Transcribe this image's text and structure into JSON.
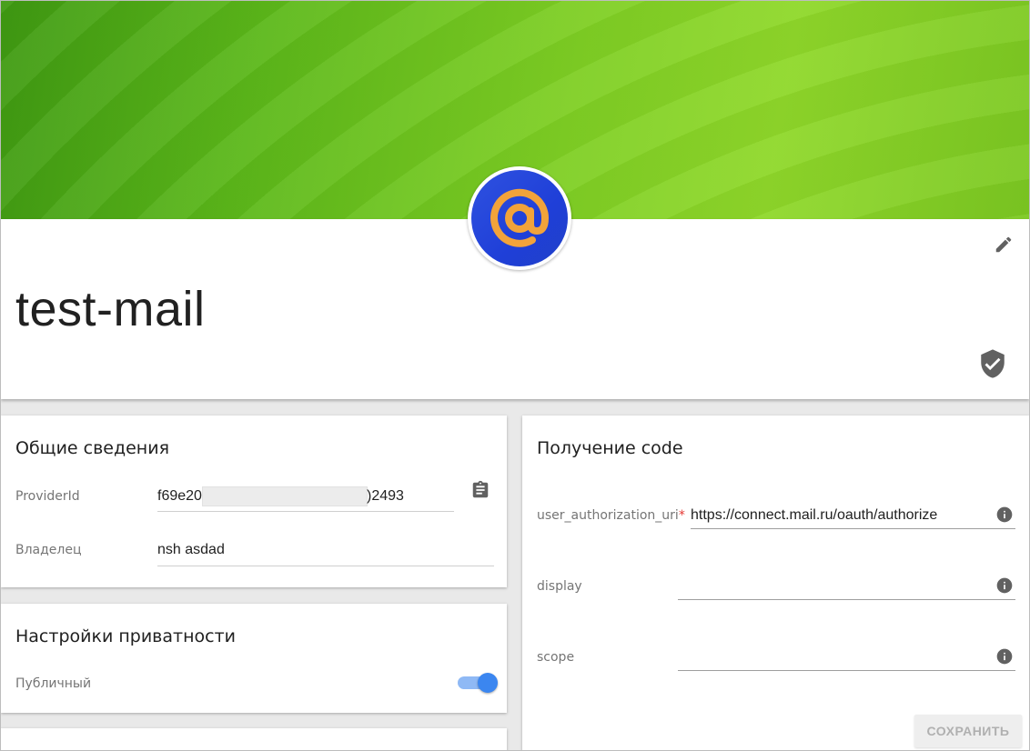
{
  "header": {
    "title": "test-mail",
    "avatar_icon": "at-sign-logo-icon",
    "edit_icon": "pencil-icon",
    "status_icon": "shield-check-icon",
    "banner_color": "#6cc31f",
    "avatar_color": "#2c4fe0",
    "avatar_glyph_color": "#f2a33a"
  },
  "general": {
    "heading": "Общие сведения",
    "provider_label": "ProviderId",
    "provider_value_start": "f69e20",
    "provider_value_end": ")2493",
    "copy_icon": "clipboard-icon",
    "owner_label": "Владелец",
    "owner_value": "nsh asdad"
  },
  "privacy": {
    "heading": "Настройки приватности",
    "public_label": "Публичный",
    "public_enabled": true,
    "toggle_color": "#3b86f0"
  },
  "code": {
    "heading": "Получение code",
    "auth_uri_label": "user_authorization_uri",
    "required_mark": "*",
    "auth_uri_value": "https://connect.mail.ru/oauth/authorize",
    "display_label": "display",
    "display_value": "",
    "scope_label": "scope",
    "scope_value": "",
    "info_icon": "info-icon",
    "save_label": "СОХРАНИТЬ"
  }
}
